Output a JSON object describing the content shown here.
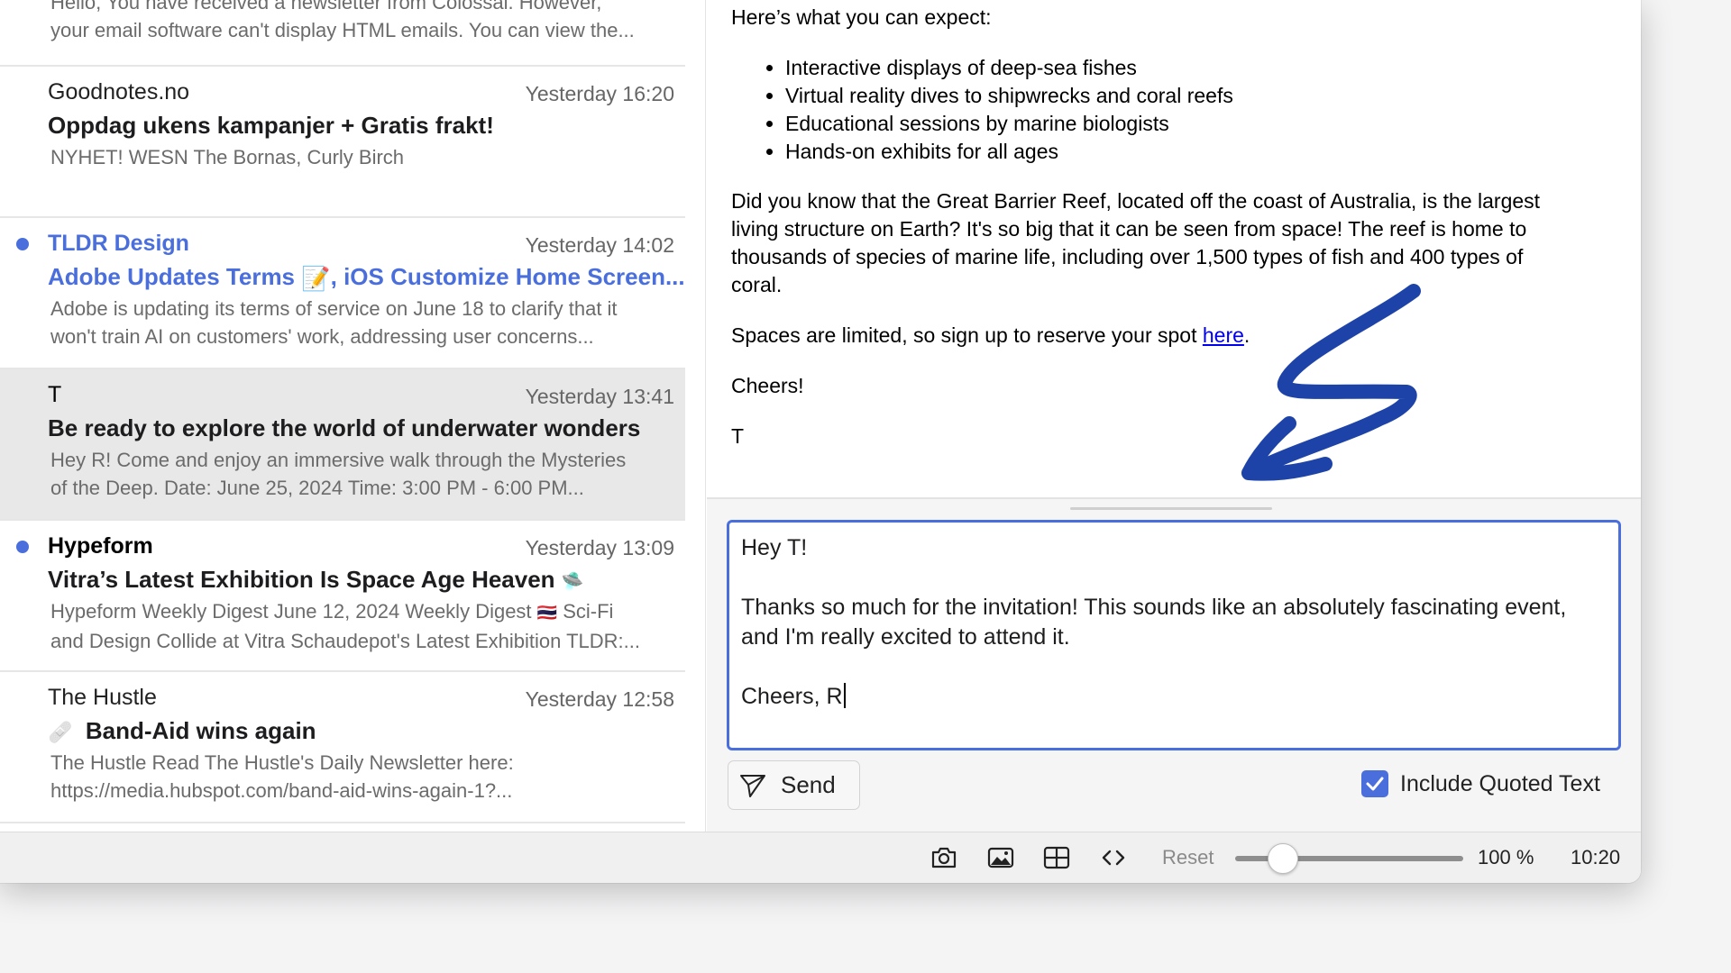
{
  "messages": [
    {
      "sender": "",
      "time": "",
      "subject": "",
      "preview": [
        "Hello, You have received a newsletter from Colossal. However,",
        "your email software can't display HTML emails. You can view the..."
      ],
      "unread": false
    },
    {
      "sender": "Goodnotes.no",
      "time": "Yesterday 16:20",
      "subject": "Oppdag ukens kampanjer + Gratis frakt!",
      "preview": [
        "NYHET! WESN The Bornas, Curly Birch"
      ],
      "unread": false
    },
    {
      "sender": "TLDR Design",
      "time": "Yesterday 14:02",
      "subject_a": "Adobe Updates Terms",
      "subject_emoji": "📝",
      "subject_b": ", iOS Customize Home Screen...",
      "preview": [
        "Adobe is updating its terms of service on June 18 to clarify that it",
        "won't train AI on customers' work, addressing user concerns..."
      ],
      "unread": true
    },
    {
      "sender": "T",
      "time": "Yesterday 13:41",
      "subject": "Be ready to explore the world of underwater wonders",
      "preview": [
        "Hey R! Come and enjoy an immersive walk through the Mysteries",
        "of the Deep. Date: June 25, 2024 Time: 3:00 PM - 6:00 PM..."
      ],
      "unread": false,
      "selected": true
    },
    {
      "sender": "Hypeform",
      "time": "Yesterday 13:09",
      "subject": "Vitra’s Latest Exhibition Is Space Age Heaven",
      "subject_emoji": "🛸",
      "preview_a": "Hypeform Weekly Digest June 12, 2024 Weekly Digest",
      "preview_emoji": "🇹🇭",
      "preview_b": " Sci-Fi",
      "preview_line2": "and Design Collide at Vitra Schaudepot's Latest Exhibition TLDR:...",
      "unread": true
    },
    {
      "sender": "The Hustle",
      "time": "Yesterday 12:58",
      "subject_emoji": "🩹",
      "subject": "Band-Aid wins again",
      "preview": [
        "The Hustle Read The Hustle's Daily Newsletter here:",
        "https://media.hubspot.com/band-aid-wins-again-1?..."
      ],
      "unread": false
    }
  ],
  "email": {
    "intro": "Here’s what you can expect:",
    "bullets": [
      "Interactive displays of deep-sea fishes",
      "Virtual reality dives to shipwrecks and coral reefs",
      "Educational sessions by marine biologists",
      "Hands-on exhibits for all ages"
    ],
    "fact": [
      "Did you know that the Great Barrier Reef, located off the coast of Australia, is the largest",
      "living structure on Earth? It's so big that it can be seen from space! The reef is home to",
      "thousands of species of marine life, including over 1,500 types of fish and 400 types of",
      "coral."
    ],
    "signup_text": "Spaces are limited, so sign up to reserve your spot ",
    "signup_link": "here",
    "signup_end": ".",
    "closing": "Cheers!",
    "signature": "T"
  },
  "reply": {
    "lines": [
      "Hey T!",
      "",
      "Thanks so much for the invitation! This sounds like an absolutely fascinating event,",
      "and I'm really excited to attend it.",
      "",
      "Cheers, R"
    ],
    "send_label": "Send",
    "include_quoted_label": "Include Quoted Text",
    "include_quoted_checked": true
  },
  "statusbar": {
    "icons": [
      "camera-icon",
      "image-icon",
      "layout-icon",
      "code-icon"
    ],
    "reset_label": "Reset",
    "zoom_label": "100 %",
    "zoom_fraction": 0.2,
    "clock": "10:20"
  },
  "colors": {
    "accent": "#4a6fdc",
    "scribble": "#1e43a8",
    "selected_row": "#e8e8e8"
  }
}
